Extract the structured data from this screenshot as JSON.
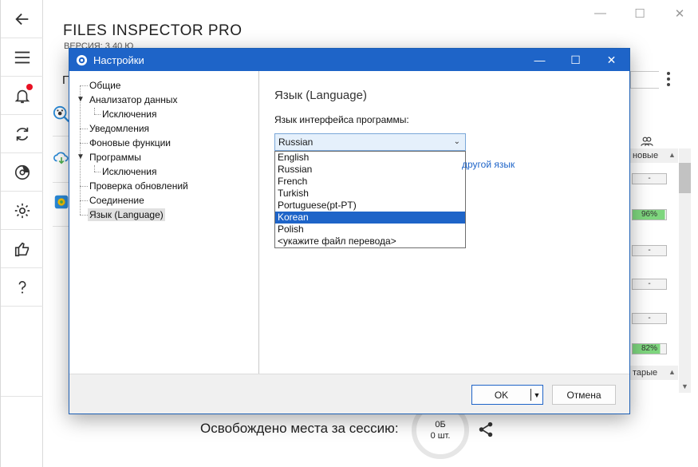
{
  "app": {
    "title": "FILES INSPECTOR PRO",
    "version": "ВЕРСИЯ: 3.40 Ю",
    "search_letter": "П",
    "window_controls": {
      "minimize": "—",
      "maximize": "☐",
      "close": "✕"
    }
  },
  "rail": {
    "icons": [
      "back-arrow-icon",
      "hamburger-menu-icon",
      "bell-icon",
      "refresh-icon",
      "disk-icon",
      "gear-icon",
      "thumbs-up-icon",
      "help-icon"
    ],
    "badge_color": "#e81123"
  },
  "table": {
    "header_top": "новые",
    "header_bottom": "тарые",
    "cells": [
      {
        "text": "-",
        "fill": 0
      },
      {
        "text": "96%",
        "fill": 0.96
      },
      {
        "text": "-",
        "fill": 0
      },
      {
        "text": "-",
        "fill": 0
      },
      {
        "text": "-",
        "fill": 0
      },
      {
        "text": "82%",
        "fill": 0.82
      }
    ]
  },
  "footer": {
    "label": "Освобождено места за сессию:",
    "size": "0Б",
    "count": "0 шт."
  },
  "dialog": {
    "title": "Настройки",
    "controls": {
      "minimize": "—",
      "maximize": "☐",
      "close": "✕"
    },
    "tree": [
      {
        "label": "Общие"
      },
      {
        "label": "Анализатор данных"
      },
      {
        "label": "Исключения"
      },
      {
        "label": "Уведомления"
      },
      {
        "label": "Фоновые функции"
      },
      {
        "label": "Программы"
      },
      {
        "label": "Исключения"
      },
      {
        "label": "Проверка обновлений"
      },
      {
        "label": "Соединение"
      },
      {
        "label": "Язык (Language)"
      }
    ],
    "section_title": "Язык (Language)",
    "language_label": "Язык интерфейса программы:",
    "selected_language": "Russian",
    "options": [
      "English",
      "Russian",
      "French",
      "Turkish",
      "Portuguese(pt-PT)",
      "Korean",
      "Polish",
      "<укажите файл перевода>"
    ],
    "highlighted_option": "Korean",
    "link_fragment": "другой язык",
    "ok_label": "OK",
    "cancel_label": "Отмена",
    "accent_color": "#1e64c8"
  }
}
